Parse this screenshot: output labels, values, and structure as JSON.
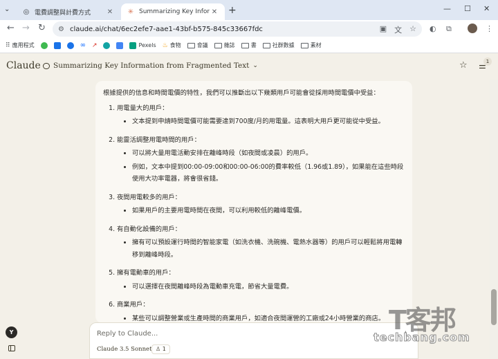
{
  "browser": {
    "tabs": [
      {
        "title": "電費調整與計費方式",
        "active": false,
        "icon": "globe-icon"
      },
      {
        "title": "Summarizing Key Information",
        "active": true,
        "icon": "claude-icon"
      }
    ],
    "url": "claude.ai/chat/6ec2efe7-aae1-43bf-b575-845c33667fdc",
    "bookmarks": [
      {
        "label": "應用程式",
        "icon": "apps-grid-icon"
      },
      {
        "label": "",
        "icon": "green-leaf-icon",
        "color": "#3fb950"
      },
      {
        "label": "",
        "icon": "blue-square-icon",
        "color": "#1a73e8"
      },
      {
        "label": "",
        "icon": "c-logo-icon",
        "color": "#1a73e8"
      },
      {
        "label": "",
        "icon": "meta-icon",
        "color": "#0866ff"
      },
      {
        "label": "",
        "icon": "trend-icon",
        "color": "#d93025"
      },
      {
        "label": "",
        "icon": "s-logo-icon",
        "color": "#12a4a4"
      },
      {
        "label": "",
        "icon": "blue-box-icon",
        "color": "#4285f4"
      },
      {
        "label": "Pexels",
        "icon": "pexels-icon",
        "color": "#05a081"
      },
      {
        "label": "食物",
        "icon": "fire-icon",
        "color": "#f29900"
      },
      {
        "label": "會議",
        "icon": "folder-icon"
      },
      {
        "label": "雜誌",
        "icon": "folder-icon"
      },
      {
        "label": "書",
        "icon": "folder-icon"
      },
      {
        "label": "社群數據",
        "icon": "folder-icon"
      },
      {
        "label": "素材",
        "icon": "folder-icon"
      }
    ]
  },
  "app": {
    "brand": "Claude",
    "chat_title": "Summarizing Key Information from Fragmented Text",
    "badge_count": "1"
  },
  "message": {
    "intro": "根據提供的信息和時間電價的特性，我們可以推斷出以下幾類用戶可能會從採用時間電價中受益：",
    "sections": [
      {
        "heading": "用電量大的用戶：",
        "bullets": [
          "文本提到申請時間電價可能需要達到700度/月的用電量。這表明大用戶更可能從中受益。"
        ]
      },
      {
        "heading": "能靈活調整用電時間的用戶：",
        "bullets": [
          "可以將大量用電活動安排在離峰時段（如夜間或凌晨）的用戶。",
          "例如，文本中提到00:00-09:00和00:00-06:00的費率較低（1.96或1.89），如果能在這些時段使用大功率電器，將會很省錢。"
        ]
      },
      {
        "heading": "夜間用電較多的用戶：",
        "bullets": [
          "如果用戶的主要用電時間在夜間，可以利用較低的離峰電價。"
        ]
      },
      {
        "heading": "有自動化設備的用戶：",
        "bullets": [
          "擁有可以預設運行時間的智能家電（如洗衣機、洗碗機、電熱水器等）的用戶可以輕鬆將用電轉移到離峰時段。"
        ]
      },
      {
        "heading": "擁有電動車的用戶：",
        "bullets": [
          "可以選擇在夜間離峰時段為電動車充電，節省大量電費。"
        ]
      },
      {
        "heading": "商業用戶：",
        "bullets": [
          "某些可以調整營業或生產時間的商業用戶，如適合夜間運營的工廠或24小時營業的商店。"
        ]
      }
    ]
  },
  "composer": {
    "placeholder": "Reply to Claude...",
    "model": "Claude 3.5 Sonnet",
    "project_count": "1"
  },
  "user": {
    "initial": "Y"
  },
  "watermark": {
    "big": "T客邦",
    "small": "techbang.com"
  }
}
